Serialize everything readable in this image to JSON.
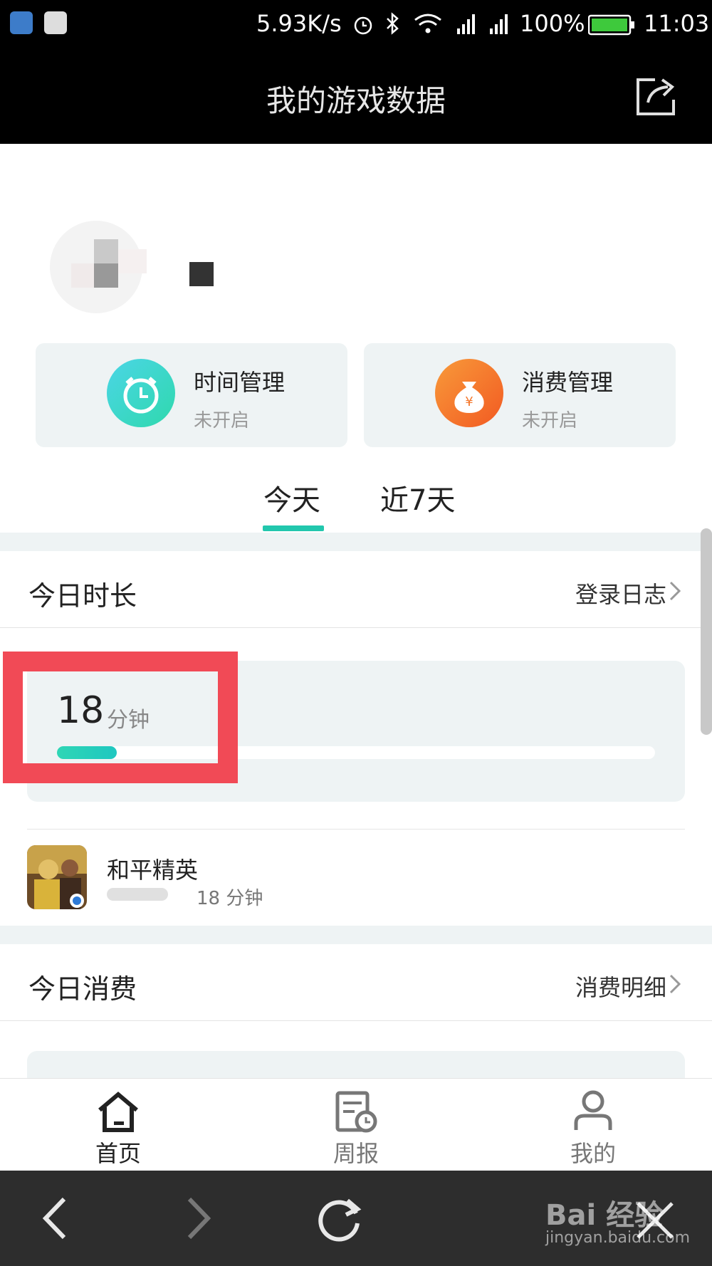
{
  "status_bar": {
    "net_speed": "5.93K/s",
    "battery": "100%",
    "time": "11:03"
  },
  "header": {
    "title": "我的游戏数据"
  },
  "cards": [
    {
      "title": "时间管理",
      "status": "未开启"
    },
    {
      "title": "消费管理",
      "status": "未开启"
    }
  ],
  "tabs": [
    {
      "label": "今天"
    },
    {
      "label": "近7天"
    }
  ],
  "today_duration": {
    "heading": "今日时长",
    "link": "登录日志",
    "minutes": "18",
    "unit": "分钟",
    "progress": 0.1
  },
  "game": {
    "name": "和平精英",
    "time": "18 分钟"
  },
  "today_spend": {
    "heading": "今日消费",
    "link": "消费明细"
  },
  "bottom_nav": [
    {
      "label": "首页"
    },
    {
      "label": "周报"
    },
    {
      "label": "我的"
    }
  ],
  "watermark": {
    "brand": "Bai 经验",
    "url": "jingyan.baidu.com"
  },
  "colors": {
    "accent": "#22c7ad",
    "highlight": "#f14a56",
    "orange": "#f4772b"
  }
}
